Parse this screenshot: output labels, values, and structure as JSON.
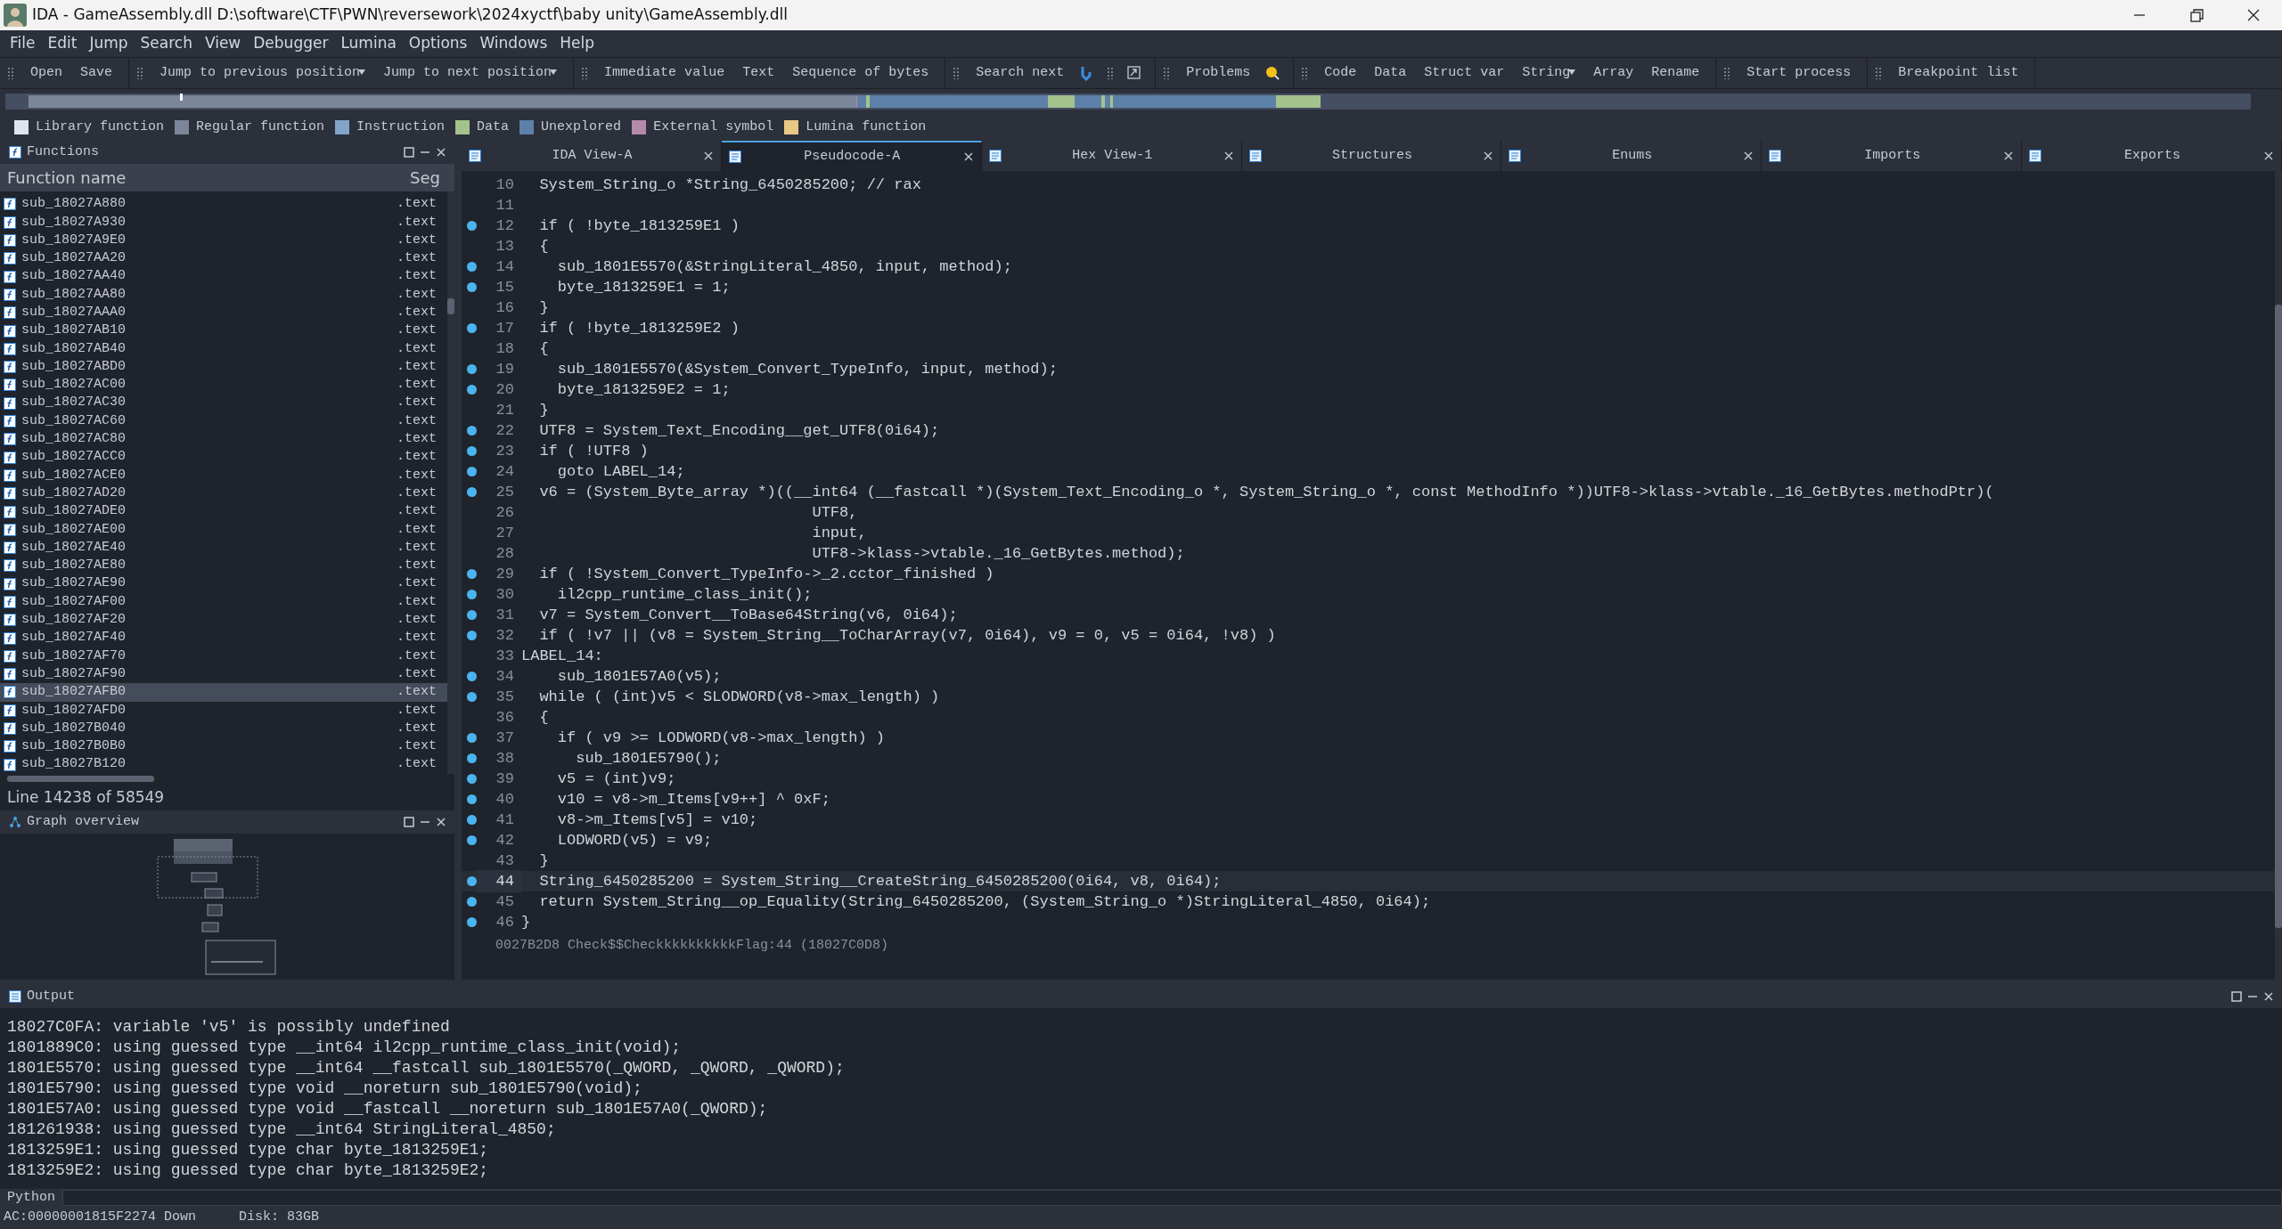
{
  "window": {
    "title": "IDA - GameAssembly.dll D:\\software\\CTF\\PWN\\reversework\\2024xyctf\\baby unity\\GameAssembly.dll"
  },
  "menu": [
    "File",
    "Edit",
    "Jump",
    "Search",
    "View",
    "Debugger",
    "Lumina",
    "Options",
    "Windows",
    "Help"
  ],
  "toolbar": [
    {
      "items": [
        {
          "label": "Open",
          "dropdown": false
        },
        {
          "label": "Save",
          "dropdown": false
        }
      ]
    },
    {
      "items": [
        {
          "label": "Jump to previous position",
          "dropdown": true
        },
        {
          "label": "Jump to next position",
          "dropdown": true
        }
      ]
    },
    {
      "items": [
        {
          "label": "Immediate value",
          "dropdown": false
        },
        {
          "label": "Text",
          "dropdown": false
        },
        {
          "label": "Sequence of bytes",
          "dropdown": false
        }
      ]
    },
    {
      "items": [
        {
          "label": "Search next",
          "dropdown": false
        }
      ]
    },
    {
      "items": [
        {
          "label": "Problems",
          "dropdown": false
        }
      ]
    },
    {
      "items": [
        {
          "label": "Code",
          "dropdown": false
        },
        {
          "label": "Data",
          "dropdown": false
        },
        {
          "label": "Struct var",
          "dropdown": false
        },
        {
          "label": "String",
          "dropdown": true
        },
        {
          "label": "Array",
          "dropdown": false
        },
        {
          "label": "Rename",
          "dropdown": false
        }
      ]
    },
    {
      "items": [
        {
          "label": "Start process",
          "dropdown": false
        }
      ]
    },
    {
      "items": [
        {
          "label": "Breakpoint list",
          "dropdown": false
        }
      ]
    }
  ],
  "legend": [
    {
      "label": "Library function",
      "color": "#dfe4ee"
    },
    {
      "label": "Regular function",
      "color": "#7c869b"
    },
    {
      "label": "Instruction",
      "color": "#82a4c9"
    },
    {
      "label": "Data",
      "color": "#a4c28b"
    },
    {
      "label": "Unexplored",
      "color": "#5d80a8"
    },
    {
      "label": "External symbol",
      "color": "#b48aa9"
    },
    {
      "label": "Lumina function",
      "color": "#e8c984"
    }
  ],
  "functions_panel": {
    "title": "Functions",
    "columns": [
      "Function name",
      "Seg"
    ],
    "rows": [
      {
        "name": "sub_18027A880",
        "segment": ".text",
        "selected": false
      },
      {
        "name": "sub_18027A930",
        "segment": ".text",
        "selected": false
      },
      {
        "name": "sub_18027A9E0",
        "segment": ".text",
        "selected": false
      },
      {
        "name": "sub_18027AA20",
        "segment": ".text",
        "selected": false
      },
      {
        "name": "sub_18027AA40",
        "segment": ".text",
        "selected": false
      },
      {
        "name": "sub_18027AA80",
        "segment": ".text",
        "selected": false
      },
      {
        "name": "sub_18027AAA0",
        "segment": ".text",
        "selected": false
      },
      {
        "name": "sub_18027AB10",
        "segment": ".text",
        "selected": false
      },
      {
        "name": "sub_18027AB40",
        "segment": ".text",
        "selected": false
      },
      {
        "name": "sub_18027ABD0",
        "segment": ".text",
        "selected": false
      },
      {
        "name": "sub_18027AC00",
        "segment": ".text",
        "selected": false
      },
      {
        "name": "sub_18027AC30",
        "segment": ".text",
        "selected": false
      },
      {
        "name": "sub_18027AC60",
        "segment": ".text",
        "selected": false
      },
      {
        "name": "sub_18027AC80",
        "segment": ".text",
        "selected": false
      },
      {
        "name": "sub_18027ACC0",
        "segment": ".text",
        "selected": false
      },
      {
        "name": "sub_18027ACE0",
        "segment": ".text",
        "selected": false
      },
      {
        "name": "sub_18027AD20",
        "segment": ".text",
        "selected": false
      },
      {
        "name": "sub_18027ADE0",
        "segment": ".text",
        "selected": false
      },
      {
        "name": "sub_18027AE00",
        "segment": ".text",
        "selected": false
      },
      {
        "name": "sub_18027AE40",
        "segment": ".text",
        "selected": false
      },
      {
        "name": "sub_18027AE80",
        "segment": ".text",
        "selected": false
      },
      {
        "name": "sub_18027AE90",
        "segment": ".text",
        "selected": false
      },
      {
        "name": "sub_18027AF00",
        "segment": ".text",
        "selected": false
      },
      {
        "name": "sub_18027AF20",
        "segment": ".text",
        "selected": false
      },
      {
        "name": "sub_18027AF40",
        "segment": ".text",
        "selected": false
      },
      {
        "name": "sub_18027AF70",
        "segment": ".text",
        "selected": false
      },
      {
        "name": "sub_18027AF90",
        "segment": ".text",
        "selected": false
      },
      {
        "name": "sub_18027AFB0",
        "segment": ".text",
        "selected": true
      },
      {
        "name": "sub_18027AFD0",
        "segment": ".text",
        "selected": false
      },
      {
        "name": "sub_18027B040",
        "segment": ".text",
        "selected": false
      },
      {
        "name": "sub_18027B0B0",
        "segment": ".text",
        "selected": false
      },
      {
        "name": "sub_18027B120",
        "segment": ".text",
        "selected": false
      }
    ],
    "status": "Line 14238 of 58549"
  },
  "graph_overview": {
    "title": "Graph overview"
  },
  "tabs": [
    {
      "label": "IDA View-A",
      "selected": false
    },
    {
      "label": "Pseudocode-A",
      "selected": true
    },
    {
      "label": "Hex View-1",
      "selected": false
    },
    {
      "label": "Structures",
      "selected": false
    },
    {
      "label": "Enums",
      "selected": false
    },
    {
      "label": "Imports",
      "selected": false
    },
    {
      "label": "Exports",
      "selected": false
    }
  ],
  "code": {
    "lines": [
      {
        "number": "10",
        "text": "  System_String_o *String_6450285200; // rax",
        "breakpoint": false,
        "selected": false
      },
      {
        "number": "11",
        "breakpoint": false,
        "selected": false
      },
      {
        "number": "12",
        "text": "  if ( !byte_1813259E1 )",
        "breakpoint": true,
        "selected": false
      },
      {
        "number": "13",
        "text": "  {",
        "breakpoint": false,
        "selected": false
      },
      {
        "number": "14",
        "text": "    sub_1801E5570(&StringLiteral_4850, input, method);",
        "breakpoint": true,
        "selected": false
      },
      {
        "number": "15",
        "text": "    byte_1813259E1 = 1;",
        "breakpoint": true,
        "selected": false
      },
      {
        "number": "16",
        "text": "  }",
        "breakpoint": false,
        "selected": false
      },
      {
        "number": "17",
        "text": "  if ( !byte_1813259E2 )",
        "breakpoint": true,
        "selected": false
      },
      {
        "number": "18",
        "text": "  {",
        "breakpoint": false,
        "selected": false
      },
      {
        "number": "19",
        "text": "    sub_1801E5570(&System_Convert_TypeInfo, input, method);",
        "breakpoint": true,
        "selected": false
      },
      {
        "number": "20",
        "text": "    byte_1813259E2 = 1;",
        "breakpoint": true,
        "selected": false
      },
      {
        "number": "21",
        "text": "  }",
        "breakpoint": false,
        "selected": false
      },
      {
        "number": "22",
        "text": "  UTF8 = System_Text_Encoding__get_UTF8(0i64);",
        "breakpoint": true,
        "selected": false
      },
      {
        "number": "23",
        "text": "  if ( !UTF8 )",
        "breakpoint": true,
        "selected": false
      },
      {
        "number": "24",
        "text": "    goto LABEL_14;",
        "breakpoint": true,
        "selected": false
      },
      {
        "number": "25",
        "text": "  v6 = (System_Byte_array *)((__int64 (__fastcall *)(System_Text_Encoding_o *, System_String_o *, const MethodInfo *))UTF8->klass->vtable._16_GetBytes.methodPtr)(",
        "breakpoint": true,
        "selected": false
      },
      {
        "number": "26",
        "text": "                                UTF8,",
        "breakpoint": false,
        "selected": false
      },
      {
        "number": "27",
        "text": "                                input,",
        "breakpoint": false,
        "selected": false
      },
      {
        "number": "28",
        "text": "                                UTF8->klass->vtable._16_GetBytes.method);",
        "breakpoint": false,
        "selected": false
      },
      {
        "number": "29",
        "text": "  if ( !System_Convert_TypeInfo->_2.cctor_finished )",
        "breakpoint": true,
        "selected": false
      },
      {
        "number": "30",
        "text": "    il2cpp_runtime_class_init();",
        "breakpoint": true,
        "selected": false
      },
      {
        "number": "31",
        "text": "  v7 = System_Convert__ToBase64String(v6, 0i64);",
        "breakpoint": true,
        "selected": false
      },
      {
        "number": "32",
        "text": "  if ( !v7 || (v8 = System_String__ToCharArray(v7, 0i64), v9 = 0, v5 = 0i64, !v8) )",
        "breakpoint": true,
        "selected": false
      },
      {
        "number": "33",
        "text": "LABEL_14:",
        "breakpoint": false,
        "selected": false
      },
      {
        "number": "34",
        "text": "    sub_1801E57A0(v5);",
        "breakpoint": true,
        "selected": false
      },
      {
        "number": "35",
        "text": "  while ( (int)v5 < SLODWORD(v8->max_length) )",
        "breakpoint": true,
        "selected": false
      },
      {
        "number": "36",
        "text": "  {",
        "breakpoint": false,
        "selected": false
      },
      {
        "number": "37",
        "text": "    if ( v9 >= LODWORD(v8->max_length) )",
        "breakpoint": true,
        "selected": false
      },
      {
        "number": "38",
        "text": "      sub_1801E5790();",
        "breakpoint": true,
        "selected": false
      },
      {
        "number": "39",
        "text": "    v5 = (int)v9;",
        "breakpoint": true,
        "selected": false
      },
      {
        "number": "40",
        "text": "    v10 = v8->m_Items[v9++] ^ 0xF;",
        "breakpoint": true,
        "selected": false
      },
      {
        "number": "41",
        "text": "    v8->m_Items[v5] = v10;",
        "breakpoint": true,
        "selected": false
      },
      {
        "number": "42",
        "text": "    LODWORD(v5) = v9;",
        "breakpoint": true,
        "selected": false
      },
      {
        "number": "43",
        "text": "  }",
        "breakpoint": false,
        "selected": false
      },
      {
        "number": "44",
        "text": "  String_6450285200 = System_String__CreateString_6450285200(0i64, v8, 0i64);",
        "breakpoint": true,
        "selected": true
      },
      {
        "number": "45",
        "text": "  return System_String__op_Equality(String_6450285200, (System_String_o *)StringLiteral_4850, 0i64);",
        "breakpoint": true,
        "selected": false
      },
      {
        "number": "46",
        "text": "}",
        "breakpoint": true,
        "selected": false
      }
    ],
    "status": "0027B2D8 Check$$CheckkkkkkkkkkFlag:44 (18027C0D8)"
  },
  "output": {
    "title": "Output",
    "lines": [
      "18027C0FA: variable 'v5' is possibly undefined",
      "1801889C0: using guessed type __int64 il2cpp_runtime_class_init(void);",
      "1801E5570: using guessed type __int64 __fastcall sub_1801E5570(_QWORD, _QWORD, _QWORD);",
      "1801E5790: using guessed type void __noreturn sub_1801E5790(void);",
      "1801E57A0: using guessed type void __fastcall __noreturn sub_1801E57A0(_QWORD);",
      "181261938: using guessed type __int64 StringLiteral_4850;",
      "1813259E1: using guessed type char byte_1813259E1;",
      "1813259E2: using guessed type char byte_1813259E2;"
    ]
  },
  "python_label": "Python",
  "status_bar": [
    "AC:00000001815F2274 Down",
    "Disk: 83GB"
  ]
}
